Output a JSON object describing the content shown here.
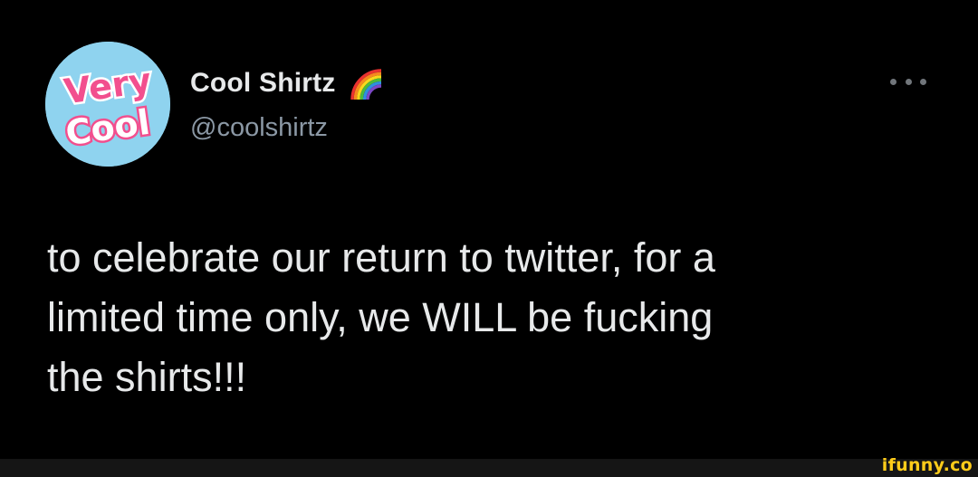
{
  "tweet": {
    "display_name": "Cool Shirtz",
    "handle": "@coolshirtz",
    "text_lines": [
      "to celebrate our return to twitter, for a",
      "limited time only, we WILL be fucking",
      "the shirts!!!"
    ],
    "avatar": {
      "logo_text_top": "Very",
      "logo_text_bottom": "Cool",
      "background_color": "#8fd3ef",
      "icon": "very-cool-logo"
    },
    "name_badge_icon": "rainbow-icon",
    "more_icon": "more-horizontal-icon"
  },
  "watermark": {
    "text": "ifunny.co",
    "color": "#ffcc1a"
  },
  "colors": {
    "background": "#000000",
    "text_primary": "#e7e9ea",
    "text_secondary": "#8b98a5"
  }
}
